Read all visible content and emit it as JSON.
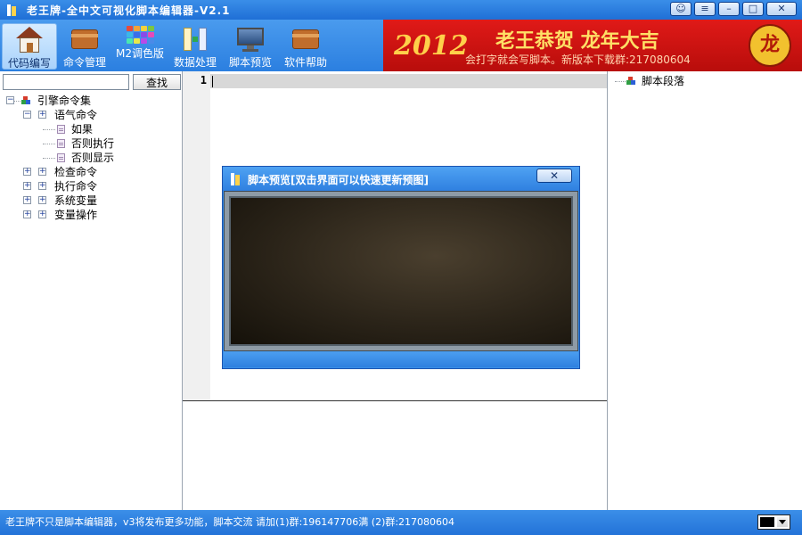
{
  "window": {
    "title": "老王牌-全中文可视化脚本编辑器-V2.1",
    "controls": [
      "chat-icon",
      "menu-icon",
      "minimize-icon",
      "maximize-icon",
      "close-icon"
    ]
  },
  "toolbar": {
    "items": [
      {
        "label": "代码编写",
        "icon": "house-icon",
        "active": true
      },
      {
        "label": "命令管理",
        "icon": "wallet-icon",
        "active": false
      },
      {
        "label": "M2调色版",
        "icon": "color-grid-icon",
        "active": false
      },
      {
        "label": "数据处理",
        "icon": "data-transfer-icon",
        "active": false
      },
      {
        "label": "脚本预览",
        "icon": "monitor-icon",
        "active": false
      },
      {
        "label": "软件帮助",
        "icon": "wallet-icon",
        "active": false
      }
    ],
    "palette_colors": [
      "#e84a3a",
      "#f2a33a",
      "#f4d23a",
      "#7bc642",
      "#3ab8e8",
      "#3a6ee8",
      "#8a4ae8",
      "#e84ab8",
      "#4ae8b0",
      "#e8e84a",
      "#b84ae8",
      "#4a8ae8"
    ]
  },
  "banner": {
    "year": "2012",
    "slogan": "老王恭贺 龙年大吉",
    "subtitle": "会打字就会写脚本。新版本下载群:217080604",
    "seal_char": "龙"
  },
  "left_panel": {
    "search_placeholder": "",
    "search_value": "",
    "search_button": "查找",
    "tree": {
      "root": "引擎命令集",
      "nodes": [
        {
          "label": "语气命令",
          "expanded": true,
          "children": [
            "如果",
            "否则执行",
            "否则显示"
          ]
        },
        {
          "label": "检查命令",
          "expanded": false,
          "children": []
        },
        {
          "label": "执行命令",
          "expanded": false,
          "children": []
        },
        {
          "label": "系统变量",
          "expanded": false,
          "children": []
        },
        {
          "label": "变量操作",
          "expanded": false,
          "children": []
        }
      ]
    }
  },
  "editor": {
    "line_number": "1",
    "content": ""
  },
  "right_panel": {
    "tree_root": "脚本段落"
  },
  "preview_dialog": {
    "title": "脚本预览[双击界面可以快速更新预图]",
    "close_glyph": "✕"
  },
  "statusbar": {
    "text": "老王牌不只是脚本编辑器，v3将发布更多功能，脚本交流 请加(1)群:196147706满 (2)群:217080604",
    "selected_color": "#000000"
  },
  "colors": {
    "titlebar": "#1f6fd6",
    "toolbar": "#2b7fe0",
    "banner": "#d0120f",
    "statusbar": "#2373d8"
  }
}
